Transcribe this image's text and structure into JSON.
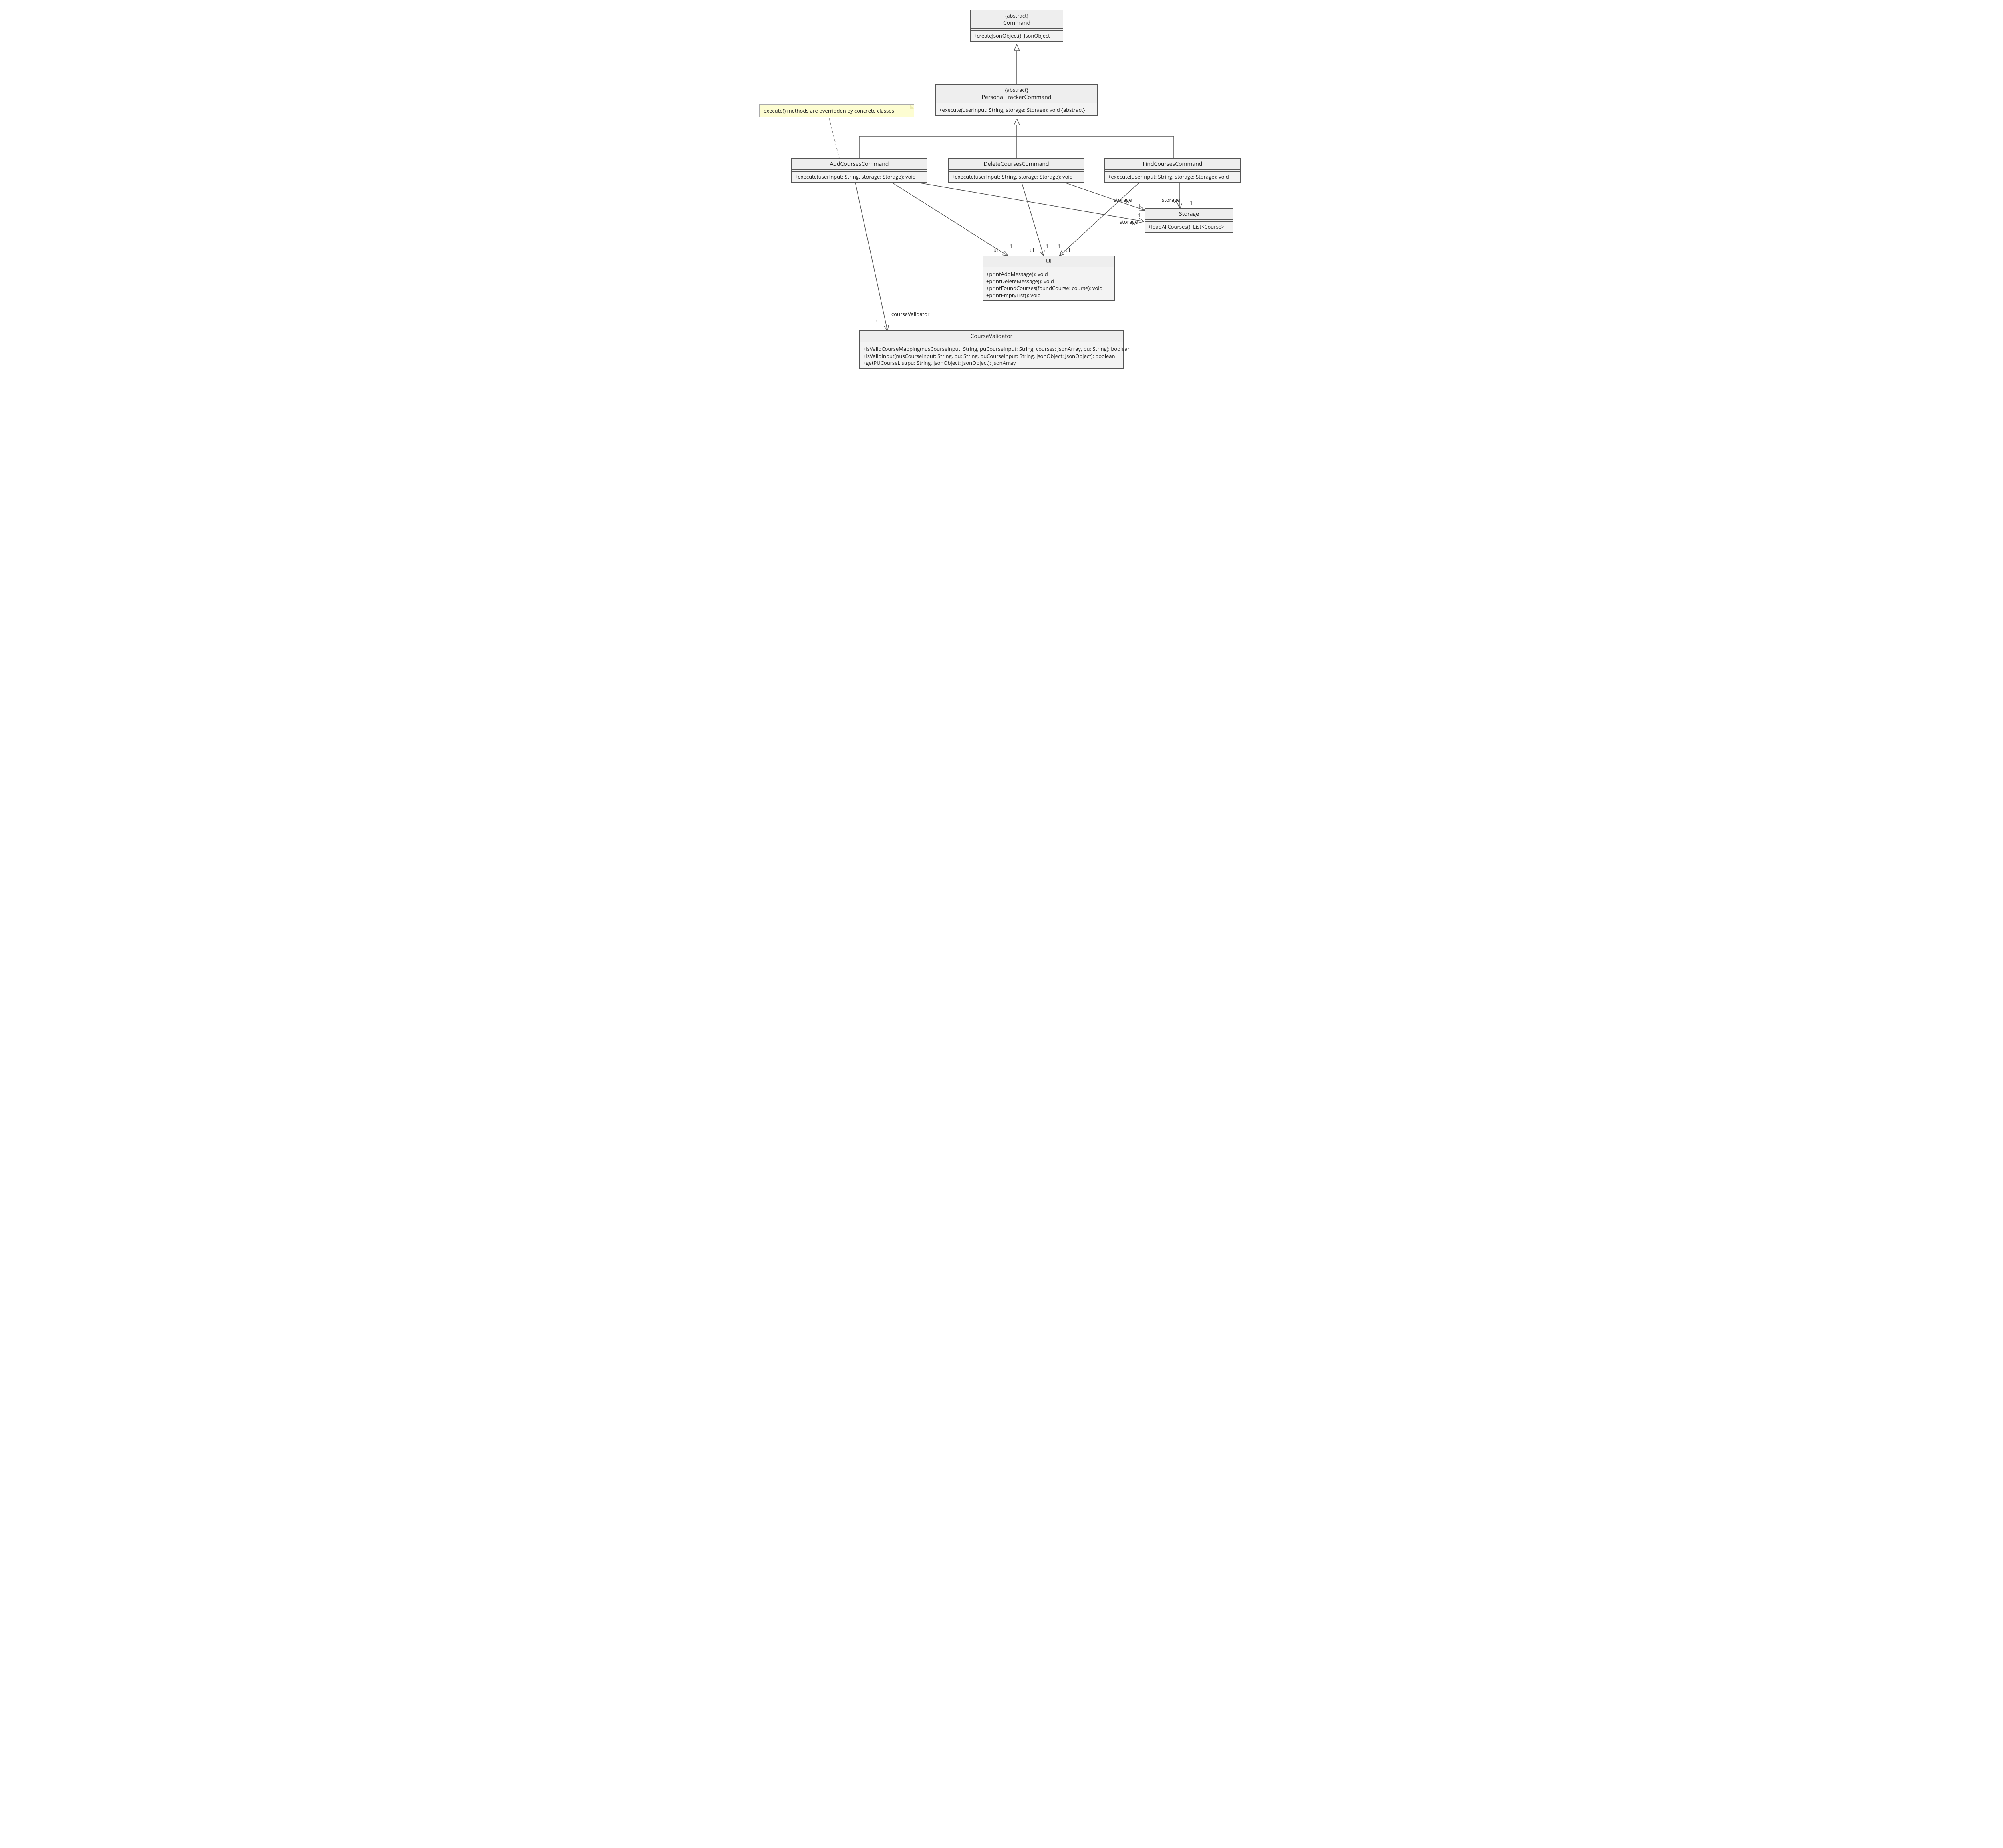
{
  "chart_data": {
    "type": "uml-class-diagram",
    "classes": [
      {
        "id": "Command",
        "stereotype": "{abstract}",
        "name": "Command",
        "members": [
          "+createJsonObject(): JsonObject"
        ]
      },
      {
        "id": "PersonalTrackerCommand",
        "stereotype": "{abstract}",
        "name": "PersonalTrackerCommand",
        "members": [
          "+execute(userInput: String, storage: Storage): void {abstract}"
        ]
      },
      {
        "id": "AddCoursesCommand",
        "name": "AddCoursesCommand",
        "members": [
          "+execute(userInput: String, storage: Storage): void"
        ]
      },
      {
        "id": "DeleteCoursesCommand",
        "name": "DeleteCoursesCommand",
        "members": [
          "+execute(userInput: String, storage: Storage): void"
        ]
      },
      {
        "id": "FindCoursesCommand",
        "name": "FindCoursesCommand",
        "members": [
          "+execute(userInput: String, storage: Storage): void"
        ]
      },
      {
        "id": "Storage",
        "name": "Storage",
        "members": [
          "+loadAllCourses(): List<Course>"
        ]
      },
      {
        "id": "UI",
        "name": "UI",
        "members": [
          "+printAddMessage(): void",
          "+printDeleteMessage(): void",
          "+printFoundCourses(foundCourse: course): void",
          "+printEmptyList(): void"
        ]
      },
      {
        "id": "CourseValidator",
        "name": "CourseValidator",
        "members": [
          "+isValidCourseMapping(nusCourseInput: String, puCourseInput: String, courses: JsonArray, pu: String): boolean",
          "+isValidInput(nusCourseInput: String, pu: String, puCourseInput: String, jsonObject: JsonObject): boolean",
          "+getPUCourseList(pu: String, jsonObject: JsonObject): JsonArray"
        ]
      }
    ],
    "relations": [
      {
        "from": "PersonalTrackerCommand",
        "to": "Command",
        "type": "generalization"
      },
      {
        "from": "AddCoursesCommand",
        "to": "PersonalTrackerCommand",
        "type": "generalization"
      },
      {
        "from": "DeleteCoursesCommand",
        "to": "PersonalTrackerCommand",
        "type": "generalization"
      },
      {
        "from": "FindCoursesCommand",
        "to": "PersonalTrackerCommand",
        "type": "generalization"
      },
      {
        "from": "AddCoursesCommand",
        "to": "UI",
        "type": "association",
        "role": "ui",
        "multiplicity": "1"
      },
      {
        "from": "DeleteCoursesCommand",
        "to": "UI",
        "type": "association",
        "role": "ui",
        "multiplicity": "1"
      },
      {
        "from": "FindCoursesCommand",
        "to": "UI",
        "type": "association",
        "role": "ui",
        "multiplicity": "1"
      },
      {
        "from": "AddCoursesCommand",
        "to": "Storage",
        "type": "association",
        "role": "storage",
        "multiplicity": "1"
      },
      {
        "from": "DeleteCoursesCommand",
        "to": "Storage",
        "type": "association",
        "role": "storage",
        "multiplicity": "1"
      },
      {
        "from": "FindCoursesCommand",
        "to": "Storage",
        "type": "association",
        "role": "storage",
        "multiplicity": "1"
      },
      {
        "from": "AddCoursesCommand",
        "to": "CourseValidator",
        "type": "association",
        "role": "courseValidator",
        "multiplicity": "1"
      },
      {
        "from": "note",
        "to": "AddCoursesCommand",
        "type": "note-anchor"
      }
    ],
    "note": "execute() methods are overridden by concrete classes"
  },
  "note_text": "execute() methods are overridden by concrete classes",
  "command": {
    "stereo": "{abstract}",
    "name": "Command",
    "m0": "+createJsonObject(): JsonObject"
  },
  "ptc": {
    "stereo": "{abstract}",
    "name": "PersonalTrackerCommand",
    "m0": "+execute(userInput: String, storage: Storage): void {abstract}"
  },
  "add": {
    "name": "AddCoursesCommand",
    "m0": "+execute(userInput: String, storage: Storage): void"
  },
  "del": {
    "name": "DeleteCoursesCommand",
    "m0": "+execute(userInput: String, storage: Storage): void"
  },
  "find": {
    "name": "FindCoursesCommand",
    "m0": "+execute(userInput: String, storage: Storage): void"
  },
  "storage": {
    "name": "Storage",
    "m0": "+loadAllCourses(): List<Course>"
  },
  "ui": {
    "name": "UI",
    "m0": "+printAddMessage(): void",
    "m1": "+printDeleteMessage(): void",
    "m2": "+printFoundCourses(foundCourse: course): void",
    "m3": "+printEmptyList(): void"
  },
  "cv": {
    "name": "CourseValidator",
    "m0": "+isValidCourseMapping(nusCourseInput: String, puCourseInput: String, courses: JsonArray, pu: String): boolean",
    "m1": "+isValidInput(nusCourseInput: String, pu: String, puCourseInput: String, jsonObject: JsonObject): boolean",
    "m2": "+getPUCourseList(pu: String, jsonObject: JsonObject): JsonArray"
  },
  "labels": {
    "ui": "ui",
    "one": "1",
    "storage": "storage",
    "courseValidator": "courseValidator"
  }
}
